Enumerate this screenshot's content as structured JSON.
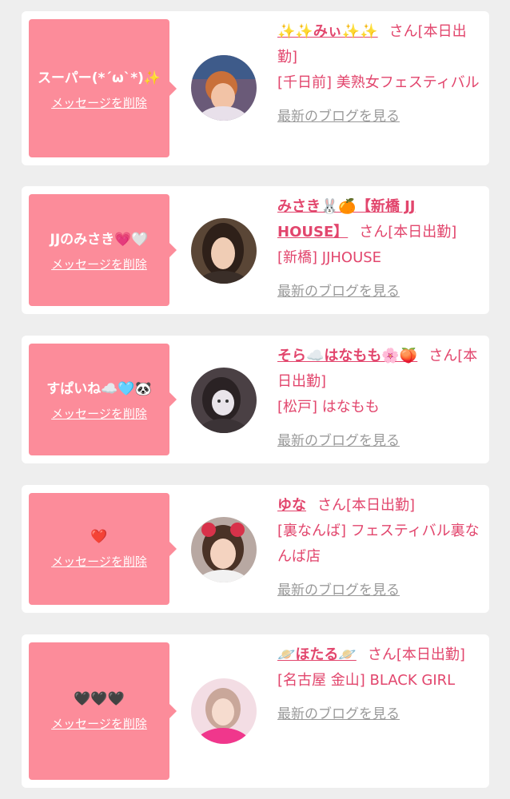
{
  "delete_label": "メッセージを削除",
  "blog_label": "最新のブログを見る",
  "cards": [
    {
      "message": "スーパー(*´ω`*)✨",
      "name": "✨✨みぃ✨✨",
      "status": "さん[本日出勤]",
      "shop": "[千日前] 美熟女フェスティバル"
    },
    {
      "message": "JJのみさき💗🤍",
      "name": "みさき🐰🍊【新橋 JJ HOUSE】",
      "status": "さん[本日出勤]",
      "shop": "[新橋] JJHOUSE"
    },
    {
      "message": "すぱいね☁️🩵🐼",
      "name": "そら☁️はなもも🌸🍑",
      "status": "さん[本日出勤]",
      "shop": "[松戸] はなもも"
    },
    {
      "message": "❤️",
      "name": "ゆな",
      "status": "さん[本日出勤]",
      "shop": "[裏なんば] フェスティバル裏なんば店"
    },
    {
      "message": "🖤🖤🖤",
      "name": "🪐ほたる🪐",
      "status": "さん[本日出勤]",
      "shop": "[名古屋 金山] BLACK GIRL"
    }
  ],
  "colors": {
    "bubble": "#fc8c9a",
    "name": "#e2466d",
    "link_gray": "#9a9a9a",
    "background": "#eeeeee"
  }
}
